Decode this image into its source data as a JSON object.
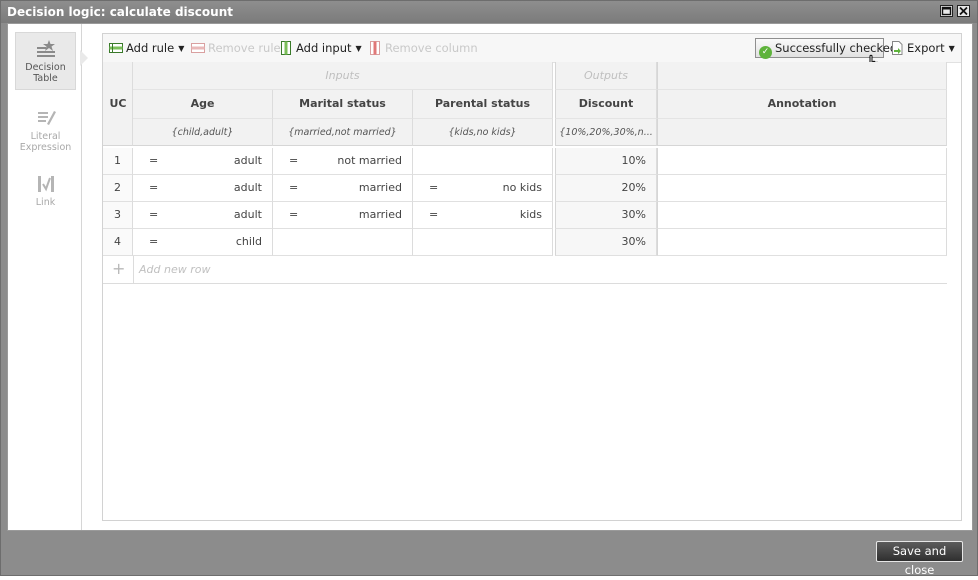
{
  "window": {
    "title": "Decision logic: calculate discount",
    "maximize_icon": "maximize-icon",
    "close_icon": "close-icon"
  },
  "sidebar": {
    "items": [
      {
        "label_line1": "Decision",
        "label_line2": "Table",
        "icon": "decision-table-icon",
        "active": true
      },
      {
        "label_line1": "Literal",
        "label_line2": "Expression",
        "icon": "literal-expression-icon",
        "active": false
      },
      {
        "label_line1": "Link",
        "label_line2": "",
        "icon": "link-icon",
        "active": false
      }
    ]
  },
  "toolbar": {
    "add_rule": "Add rule",
    "remove_rule": "Remove rule",
    "add_input": "Add input",
    "remove_column": "Remove column",
    "status": "Successfully checked",
    "export": "Export"
  },
  "table": {
    "group_inputs": "Inputs",
    "group_outputs": "Outputs",
    "hit_policy": "UC",
    "columns": [
      {
        "name": "Age",
        "values": "{child,adult}"
      },
      {
        "name": "Marital status",
        "values": "{married,not married}"
      },
      {
        "name": "Parental status",
        "values": "{kids,no kids}"
      },
      {
        "name": "Discount",
        "values": "{10%,20%,30%,n..."
      },
      {
        "name": "Annotation",
        "values": ""
      }
    ],
    "rows": [
      {
        "num": "1",
        "age_op": "=",
        "age": "adult",
        "marital_op": "=",
        "marital": "not married",
        "parental_op": "",
        "parental": "",
        "discount": "10%",
        "annotation": ""
      },
      {
        "num": "2",
        "age_op": "=",
        "age": "adult",
        "marital_op": "=",
        "marital": "married",
        "parental_op": "=",
        "parental": "no kids",
        "discount": "20%",
        "annotation": ""
      },
      {
        "num": "3",
        "age_op": "=",
        "age": "adult",
        "marital_op": "=",
        "marital": "married",
        "parental_op": "=",
        "parental": "kids",
        "discount": "30%",
        "annotation": ""
      },
      {
        "num": "4",
        "age_op": "=",
        "age": "child",
        "marital_op": "",
        "marital": "",
        "parental_op": "",
        "parental": "",
        "discount": "30%",
        "annotation": ""
      }
    ],
    "add_row": "Add new row"
  },
  "footer": {
    "save_and_close": "Save and close"
  },
  "colors": {
    "status_ok": "#5eb33b",
    "chrome": "#8c8c8c"
  }
}
